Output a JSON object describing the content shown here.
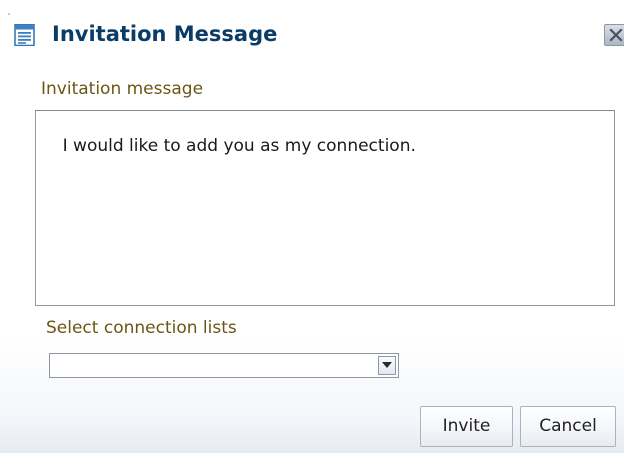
{
  "dialog": {
    "title": "Invitation Message",
    "title_icon": "document-icon",
    "close_icon": "close-icon"
  },
  "message": {
    "label": "Invitation message",
    "value": "I would like to add you as my connection."
  },
  "connection_lists": {
    "label": "Select connection lists",
    "selected_value": "",
    "dropdown_icon": "chevron-down-icon"
  },
  "buttons": {
    "invite_label": "Invite",
    "cancel_label": "Cancel"
  },
  "colors": {
    "title": "#0b3c66",
    "field_label": "#6b5616",
    "icon_blue": "#2f6fb3"
  }
}
